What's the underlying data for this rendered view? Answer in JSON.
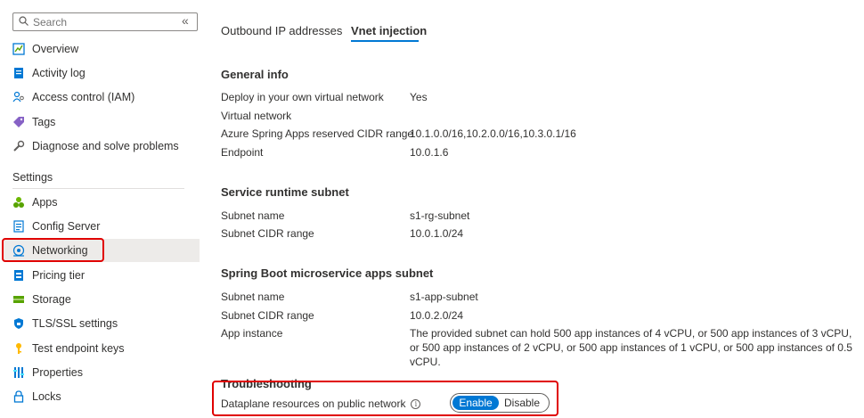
{
  "sidebar": {
    "search_placeholder": "Search",
    "collapse_glyph": "«",
    "items_top": [
      {
        "label": "Overview",
        "icon": "overview-icon"
      },
      {
        "label": "Activity log",
        "icon": "activity-log-icon"
      },
      {
        "label": "Access control (IAM)",
        "icon": "access-control-icon"
      },
      {
        "label": "Tags",
        "icon": "tag-icon"
      },
      {
        "label": "Diagnose and solve problems",
        "icon": "wrench-icon"
      }
    ],
    "settings_label": "Settings",
    "items_settings": [
      {
        "label": "Apps",
        "icon": "apps-icon"
      },
      {
        "label": "Config Server",
        "icon": "config-server-icon"
      },
      {
        "label": "Networking",
        "icon": "networking-icon",
        "active": true
      },
      {
        "label": "Pricing tier",
        "icon": "pricing-tier-icon"
      },
      {
        "label": "Storage",
        "icon": "storage-icon"
      },
      {
        "label": "TLS/SSL settings",
        "icon": "shield-icon"
      },
      {
        "label": "Test endpoint keys",
        "icon": "key-icon"
      },
      {
        "label": "Properties",
        "icon": "properties-icon"
      },
      {
        "label": "Locks",
        "icon": "lock-icon"
      }
    ]
  },
  "tabs": [
    {
      "label": "Outbound IP addresses",
      "selected": false
    },
    {
      "label": "Vnet injection",
      "selected": true
    }
  ],
  "general_info": {
    "title": "General info",
    "rows": [
      {
        "label": "Deploy in your own virtual network",
        "value": "Yes"
      },
      {
        "label": "Virtual network",
        "value": ""
      },
      {
        "label": "Azure Spring Apps reserved CIDR range",
        "value": "10.1.0.0/16,10.2.0.0/16,10.3.0.1/16"
      },
      {
        "label": "Endpoint",
        "value": "10.0.1.6"
      }
    ]
  },
  "service_runtime": {
    "title": "Service runtime subnet",
    "rows": [
      {
        "label": "Subnet name",
        "value": "s1-rg-subnet"
      },
      {
        "label": "Subnet CIDR range",
        "value": "10.0.1.0/24"
      }
    ]
  },
  "apps_subnet": {
    "title": "Spring Boot microservice apps subnet",
    "rows": [
      {
        "label": "Subnet name",
        "value": "s1-app-subnet"
      },
      {
        "label": "Subnet CIDR range",
        "value": "10.0.2.0/24"
      },
      {
        "label": "App instance",
        "value": "The provided subnet can hold 500 app instances of 4 vCPU, or 500 app instances of 3 vCPU, or 500 app instances of 2 vCPU, or 500 app instances of 1 vCPU, or 500 app instances of 0.5 vCPU."
      }
    ]
  },
  "troubleshooting": {
    "title": "Troubleshooting",
    "dataplane_label": "Dataplane resources on public network",
    "info_glyph": "i",
    "toggle": {
      "enable": "Enable",
      "disable": "Disable",
      "selected": "Enable"
    }
  },
  "colors": {
    "accent": "#0078d4",
    "highlight": "#e00000",
    "active_bg": "#edebe9"
  }
}
